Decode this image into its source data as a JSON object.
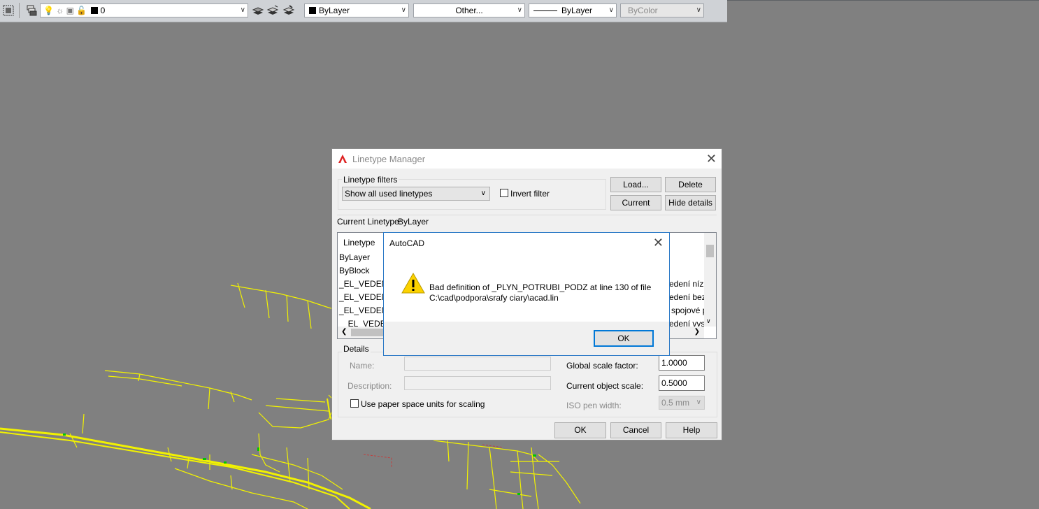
{
  "toolbar": {
    "layer_name": "0",
    "color_value": "ByLayer",
    "linetype_value": "Other...",
    "lineweight_value": "ByLayer",
    "plotstyle_value": "ByColor"
  },
  "linetype_manager": {
    "title": "Linetype Manager",
    "filters_group": "Linetype filters",
    "filter_value": "Show all used linetypes",
    "invert_filter_label": "Invert filter",
    "load_button": "Load...",
    "delete_button": "Delete",
    "current_button": "Current",
    "hide_details_button": "Hide details",
    "current_linetype_label": "Current Linetype:",
    "current_linetype_value": "ByLayer",
    "column_linetype": "Linetype",
    "rows": [
      {
        "name": "ByLayer",
        "desc": ""
      },
      {
        "name": "ByBlock",
        "desc": ""
      },
      {
        "name": "_EL_VEDENI",
        "desc": "edení nízk"
      },
      {
        "name": "_EL_VEDENI",
        "desc": "edení bez"
      },
      {
        "name": "_EL_VEDENI",
        "desc": "spojové p"
      },
      {
        "name": "_EL_VEDENI",
        "desc": "edení vysc"
      }
    ],
    "details_group": "Details",
    "name_label": "Name:",
    "description_label": "Description:",
    "paper_space_label": "Use paper space units for scaling",
    "global_scale_label": "Global scale factor:",
    "global_scale_value": "1.0000",
    "object_scale_label": "Current object scale:",
    "object_scale_value": "0.5000",
    "iso_pen_label": "ISO pen width:",
    "iso_pen_value": "0.5 mm",
    "ok_button": "OK",
    "cancel_button": "Cancel",
    "help_button": "Help"
  },
  "alert": {
    "title": "AutoCAD",
    "message_line1": "Bad definition of _PLYN_POTRUBI_PODZ at line 130 of file",
    "message_line2": "C:\\cad\\podpora\\srafy ciary\\acad.lin",
    "ok_button": "OK"
  },
  "colors": {
    "canvas": "#808080",
    "drawing_lines": "#f2f200",
    "accent_green": "#00c800",
    "accent_red": "#c04040",
    "focus_blue": "#0078d7",
    "logo_red": "#d22"
  }
}
